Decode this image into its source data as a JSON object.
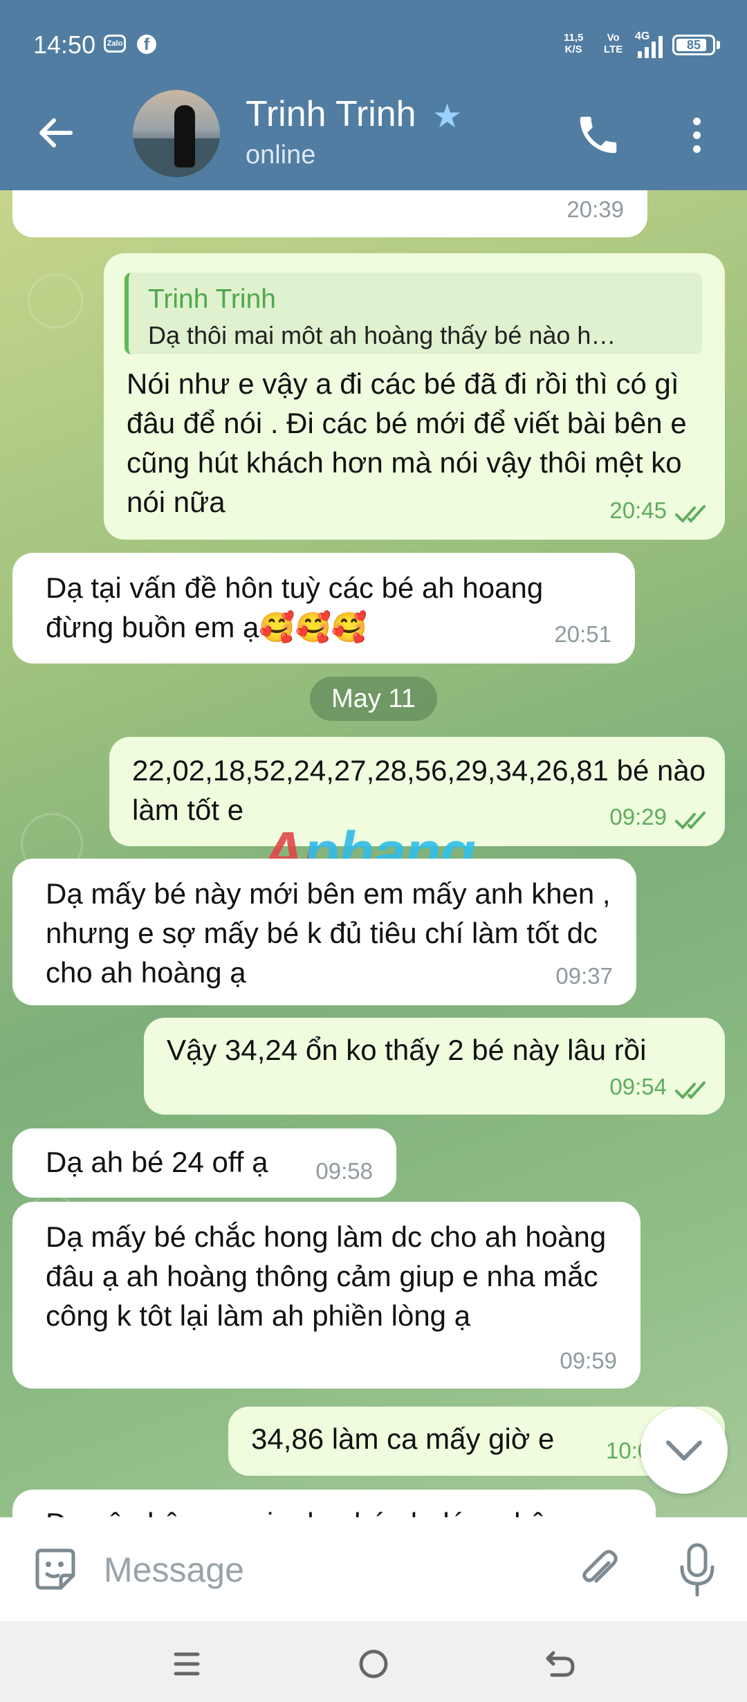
{
  "status_bar": {
    "time": "14:50",
    "zalo_label": "Zalo",
    "fb_label": "f",
    "net_speed_value": "11,5",
    "net_speed_unit": "K/S",
    "volte_top": "Vo",
    "volte_bottom": "LTE",
    "network": "4G",
    "battery": "85",
    "battery_level": 0.85
  },
  "header": {
    "contact_name": "Trinh Trinh",
    "contact_status": "online",
    "verified_icon": "star-icon"
  },
  "messages": [
    {
      "dir": "in",
      "text": "",
      "time": "20:39"
    },
    {
      "dir": "out",
      "reply_name": "Trinh Trinh",
      "reply_text": "Dạ thôi mai môt ah hoàng thấy bé nào h…",
      "text": "Nói như e vậy a đi các bé đã đi rồi thì có gì đâu để nói . Đi các bé mới để viết bài bên e cũng hút khách hơn mà nói vậy thôi mệt ko nói nữa",
      "time": "20:45",
      "read": true
    },
    {
      "dir": "in",
      "text": "Dạ tại vấn đề hôn tuỳ các bé ah hoang đừng buồn em ạ🥰🥰🥰",
      "time": "20:51"
    },
    {
      "dir": "out",
      "text": "22,02,18,52,24,27,28,56,29,34,26,81 bé nào làm tốt e",
      "time": "09:29",
      "read": true
    },
    {
      "dir": "in",
      "text": "Dạ mấy bé này mới bên em mấy anh khen , nhưng e sợ mấy bé k đủ tiêu chí làm tốt dc cho ah hoàng ạ",
      "time": "09:37"
    },
    {
      "dir": "out",
      "text": "Vậy 34,24 ổn ko thấy 2 bé này lâu rồi",
      "time": "09:54",
      "read": true
    },
    {
      "dir": "in",
      "text": "Dạ ah bé 24 off ạ",
      "time": "09:58"
    },
    {
      "dir": "in",
      "text": "Dạ mấy bé chắc hong làm dc cho ah hoàng đâu ạ ah hoàng thông cảm giup e nha mắc công k tôt lại làm ah phiền lòng ạ",
      "time": "09:59"
    },
    {
      "dir": "out",
      "text": "34,86 làm ca mấy giờ e",
      "time": "10:0"
    },
    {
      "dir": "in",
      "text": "Dạ nên bên em xin dạ phép k dám nhận",
      "time": ""
    }
  ],
  "date_separator": "May 11",
  "watermark": "Aphang",
  "input": {
    "placeholder": "Message"
  },
  "colors": {
    "header": "#517da2",
    "outgoing_bubble": "#effdde",
    "incoming_bubble": "#ffffff",
    "accent_green": "#5fac5e"
  }
}
